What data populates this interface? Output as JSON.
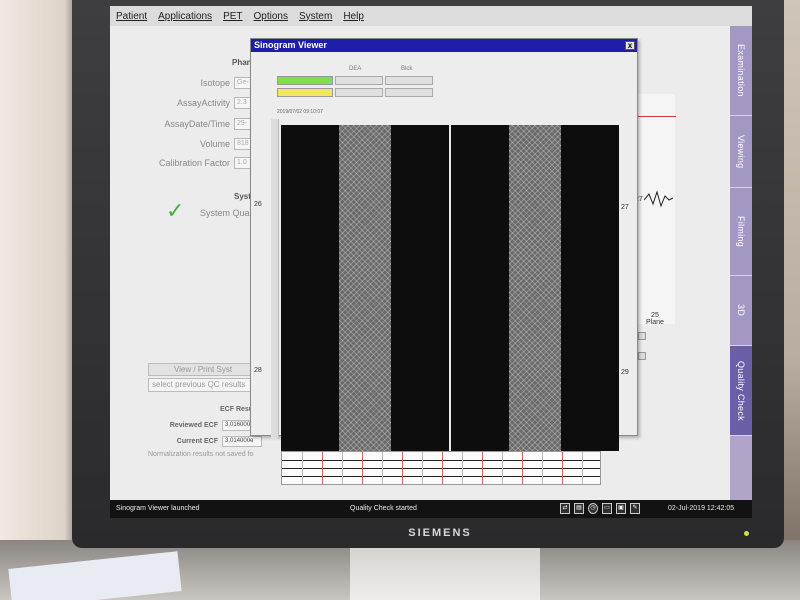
{
  "menubar": {
    "items": [
      "Patient",
      "Applications",
      "PET",
      "Options",
      "System",
      "Help"
    ]
  },
  "main": {
    "phantom_header": "Phant",
    "fields": [
      {
        "label": "Isotope",
        "value": "Ge-"
      },
      {
        "label": "AssayActivity",
        "value": "2.3"
      },
      {
        "label": "AssayDate/Time",
        "value": "29-"
      },
      {
        "label": "Volume",
        "value": "818"
      },
      {
        "label": "Calibration Factor",
        "value": "1.0"
      }
    ],
    "system_header": "Syste",
    "system_quality": "System Quality",
    "view_print_button": "View / Print Syst",
    "select_previous_placeholder": "select previous QC results",
    "ecf_header": "ECF Result",
    "reviewed_ecf_label": "Reviewed ECF",
    "reviewed_ecf_value": "3.016000e",
    "current_ecf_label": "Current ECF",
    "current_ecf_value": "3.014000e",
    "normalization_msg": "Normalization results not saved fo",
    "bottom_button": "S"
  },
  "bgchart": {
    "value_27": "27",
    "plane_num": "25",
    "plane_label": "Plane"
  },
  "viewer": {
    "title": "Sinogram Viewer",
    "close_glyph": "x",
    "legend_col1": "DEA",
    "legend_col2": "Blck",
    "timestamp": "2019/07/02 09:10:07",
    "left_top_num": "26",
    "left_bottom_num": "28",
    "right_top_num": "27",
    "right_bottom_num": "29",
    "colors": {
      "green": "#7ee04a",
      "yellow": "#f1e75a"
    }
  },
  "sidetabs": [
    "Examination",
    "Viewing",
    "Filming",
    "3D",
    "Quality Check"
  ],
  "status": {
    "left": "Sinogram Viewer launched",
    "center": "Quality Check started",
    "time": "02-Jul-2019 12:42:05",
    "icons": [
      "network-icon",
      "printer-icon",
      "clock-icon",
      "monitor-icon",
      "disk-icon",
      "tool-icon"
    ]
  },
  "monitor": {
    "brand": "SIEMENS"
  }
}
